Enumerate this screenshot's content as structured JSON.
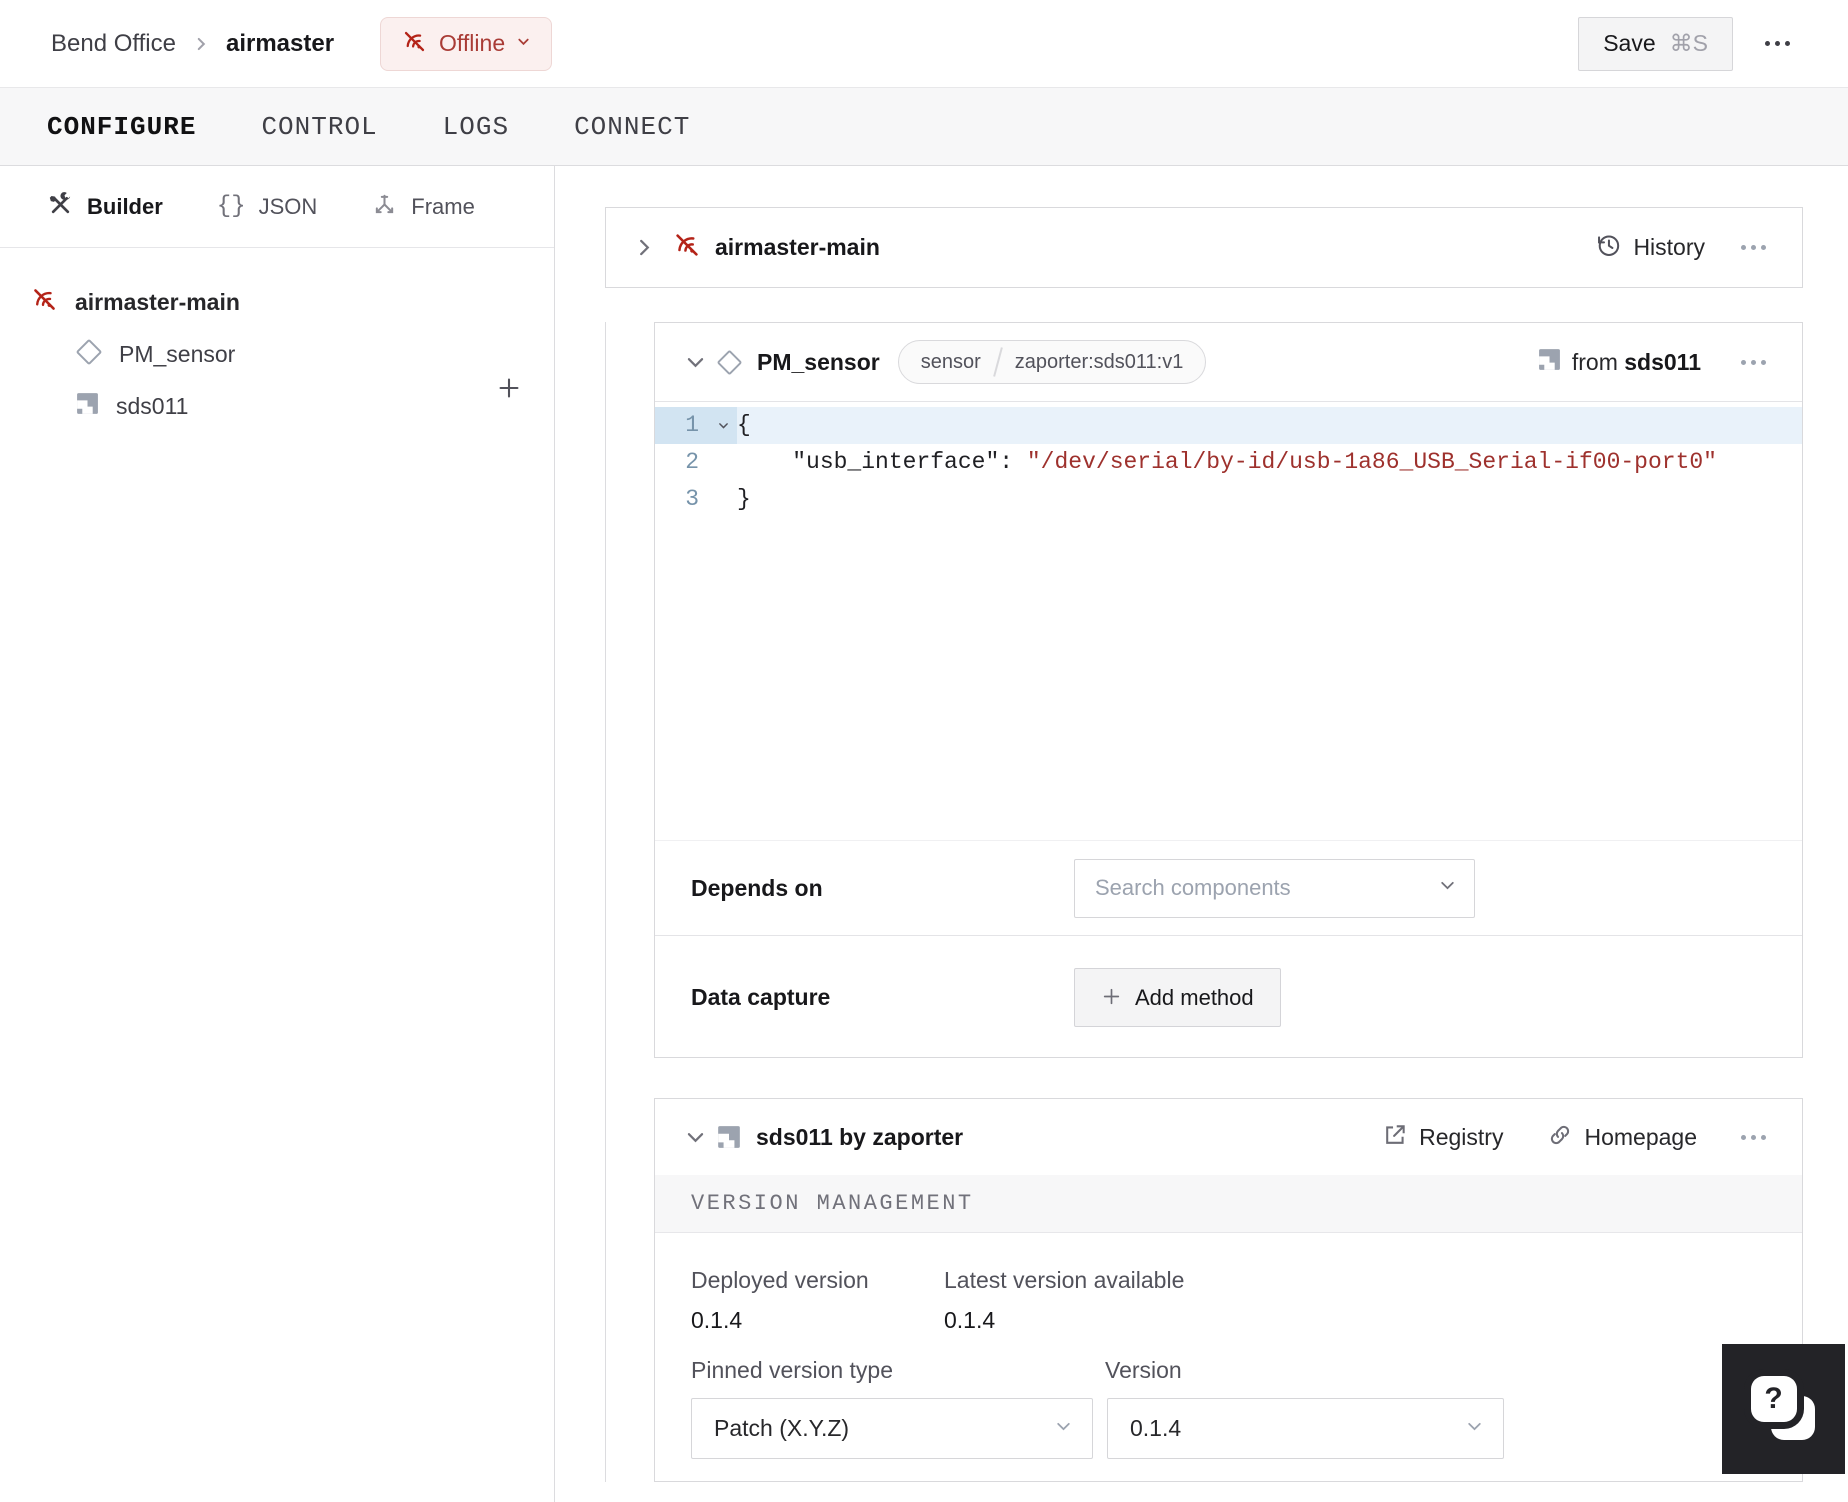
{
  "colors": {
    "offline_red": "#b42318",
    "code_value_red": "#9e312d",
    "active_line_blue": "#e9f2fa"
  },
  "topbar": {
    "location": "Bend Office",
    "machine": "airmaster",
    "status": {
      "label": "Offline"
    },
    "save": {
      "label": "Save",
      "shortcut": "⌘S"
    }
  },
  "tabs": [
    {
      "label": "CONFIGURE"
    },
    {
      "label": "CONTROL"
    },
    {
      "label": "LOGS"
    },
    {
      "label": "CONNECT"
    }
  ],
  "sidebar": {
    "modes": [
      {
        "label": "Builder"
      },
      {
        "label": "JSON"
      },
      {
        "label": "Frame"
      }
    ],
    "tree": {
      "root": "airmaster-main",
      "children": [
        {
          "label": "PM_sensor"
        },
        {
          "label": "sds011"
        }
      ]
    }
  },
  "part_card": {
    "title": "airmaster-main",
    "history_label": "History"
  },
  "component_card": {
    "title": "PM_sensor",
    "tags": [
      {
        "label": "sensor"
      },
      {
        "label": "zaporter:sds011:v1"
      }
    ],
    "from_prefix": "from",
    "from_module": "sds011",
    "depends": {
      "label": "Depends on",
      "placeholder": "Search components"
    },
    "capture": {
      "label": "Data capture",
      "button": "Add method"
    }
  },
  "code": {
    "nums": [
      {
        "n": "1"
      },
      {
        "n": "2"
      },
      {
        "n": "3"
      }
    ],
    "l1": "{",
    "l2_indent": "    ",
    "l2_key": "\"usb_interface\"",
    "l2_colon": ": ",
    "l2_value": "\"/dev/serial/by-id/usb-1a86_USB_Serial-if00-port0\"",
    "l3": "}"
  },
  "module_card": {
    "title": "sds011 by zaporter",
    "registry_label": "Registry",
    "homepage_label": "Homepage",
    "section_title": "VERSION MANAGEMENT",
    "deployed": {
      "label": "Deployed version",
      "value": "0.1.4"
    },
    "latest": {
      "label": "Latest version available",
      "value": "0.1.4"
    },
    "pinned": {
      "label": "Pinned version type",
      "value": "Patch (X.Y.Z)"
    },
    "version": {
      "label": "Version",
      "value": "0.1.4"
    }
  },
  "help": {
    "glyph": "?"
  }
}
